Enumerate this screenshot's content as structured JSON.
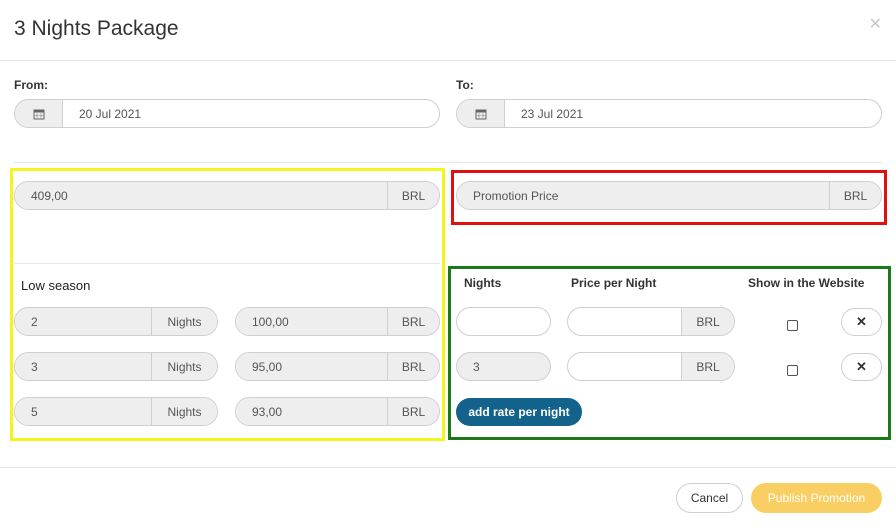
{
  "modal": {
    "title": "3 Nights Package",
    "close_icon": "close-icon"
  },
  "dates": {
    "from_label": "From:",
    "from_value": "20 Jul 2021",
    "to_label": "To:",
    "to_value": "23 Jul 2021",
    "icon": "calendar-icon"
  },
  "pricing": {
    "price_value": "409,00",
    "currency": "BRL",
    "promotion_placeholder": "Promotion Price"
  },
  "season": {
    "name": "Low season",
    "nights_unit": "Nights",
    "rows": [
      {
        "nights": "2",
        "price": "100,00"
      },
      {
        "nights": "3",
        "price": "95,00"
      },
      {
        "nights": "5",
        "price": "93,00"
      }
    ]
  },
  "promo_rates": {
    "col_nights": "Nights",
    "col_price": "Price per Night",
    "col_show": "Show in the Website",
    "rows": [
      {
        "nights": "",
        "price": "",
        "show": false
      },
      {
        "nights": "3",
        "price": "",
        "show": false
      }
    ],
    "add_label": "add rate per night",
    "remove_icon": "x-icon"
  },
  "footer": {
    "cancel_label": "Cancel",
    "publish_label": "Publish Promotion"
  },
  "colors": {
    "accent": "#13628c",
    "publish": "#f9cf63",
    "highlight_yellow": "#f5f51e",
    "highlight_red": "#e01010",
    "highlight_green": "#1a7a1a"
  }
}
